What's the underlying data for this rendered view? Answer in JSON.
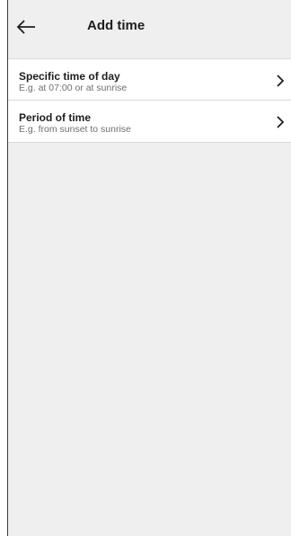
{
  "header": {
    "title": "Add time",
    "back_icon": "arrow-left-icon"
  },
  "options": [
    {
      "title": "Specific time of day",
      "subtitle": "E.g. at 07:00 or at sunrise",
      "icon": "chevron-right-icon"
    },
    {
      "title": "Period of time",
      "subtitle": "E.g. from sunset to sunrise",
      "icon": "chevron-right-icon"
    }
  ],
  "colors": {
    "background": "#efefef",
    "row_background": "#ffffff",
    "text_primary": "#1e1e1e",
    "text_secondary": "#6f6f6f"
  }
}
